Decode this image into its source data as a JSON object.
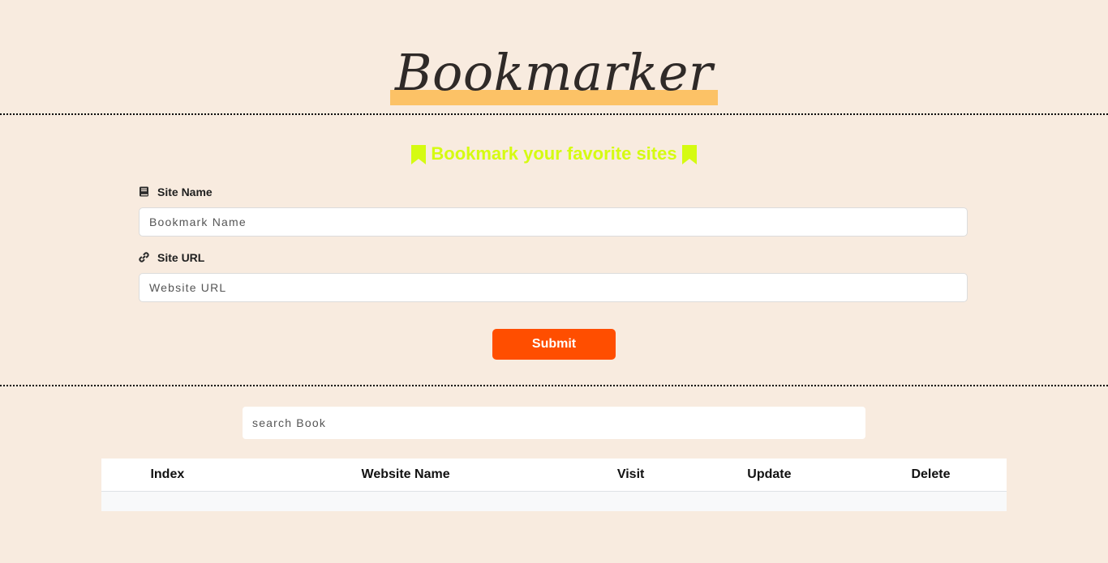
{
  "header": {
    "logo_text": "Bookmarker",
    "highlight_color": "#fcc266"
  },
  "form": {
    "subtitle": "Bookmark your favorite sites",
    "subtitle_color": "#d5fb11",
    "site_name_label": "Site Name",
    "site_name_icon": "book-icon",
    "site_name_placeholder": "Bookmark Name",
    "site_name_value": "",
    "site_url_label": "Site URL",
    "site_url_icon": "link-icon",
    "site_url_placeholder": "Website URL",
    "site_url_value": "",
    "submit_label": "Submit",
    "submit_color": "#ff4e00"
  },
  "search": {
    "placeholder": "search Book",
    "value": ""
  },
  "table": {
    "columns": [
      "Index",
      "Website Name",
      "Visit",
      "Update",
      "Delete"
    ],
    "rows": []
  },
  "colors": {
    "background": "#f8ebdf"
  }
}
